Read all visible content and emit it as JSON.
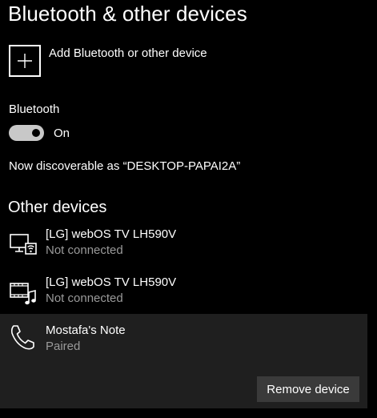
{
  "header": {
    "title": "Bluetooth & other devices"
  },
  "add_device": {
    "label": "Add Bluetooth or other device",
    "icon": "plus-icon"
  },
  "bluetooth": {
    "heading": "Bluetooth",
    "toggle_state": "On",
    "enabled": true,
    "discoverable_text": "Now discoverable as “DESKTOP-PAPAI2A”"
  },
  "other_devices": {
    "title": "Other devices",
    "items": [
      {
        "name": "[LG] webOS TV LH590V",
        "status": "Not connected",
        "icon": "display-wireless-icon"
      },
      {
        "name": "[LG] webOS TV LH590V",
        "status": "Not connected",
        "icon": "media-device-icon"
      },
      {
        "name": "Mostafa's Note",
        "status": "Paired",
        "icon": "phone-icon"
      }
    ],
    "remove_label": "Remove device"
  }
}
